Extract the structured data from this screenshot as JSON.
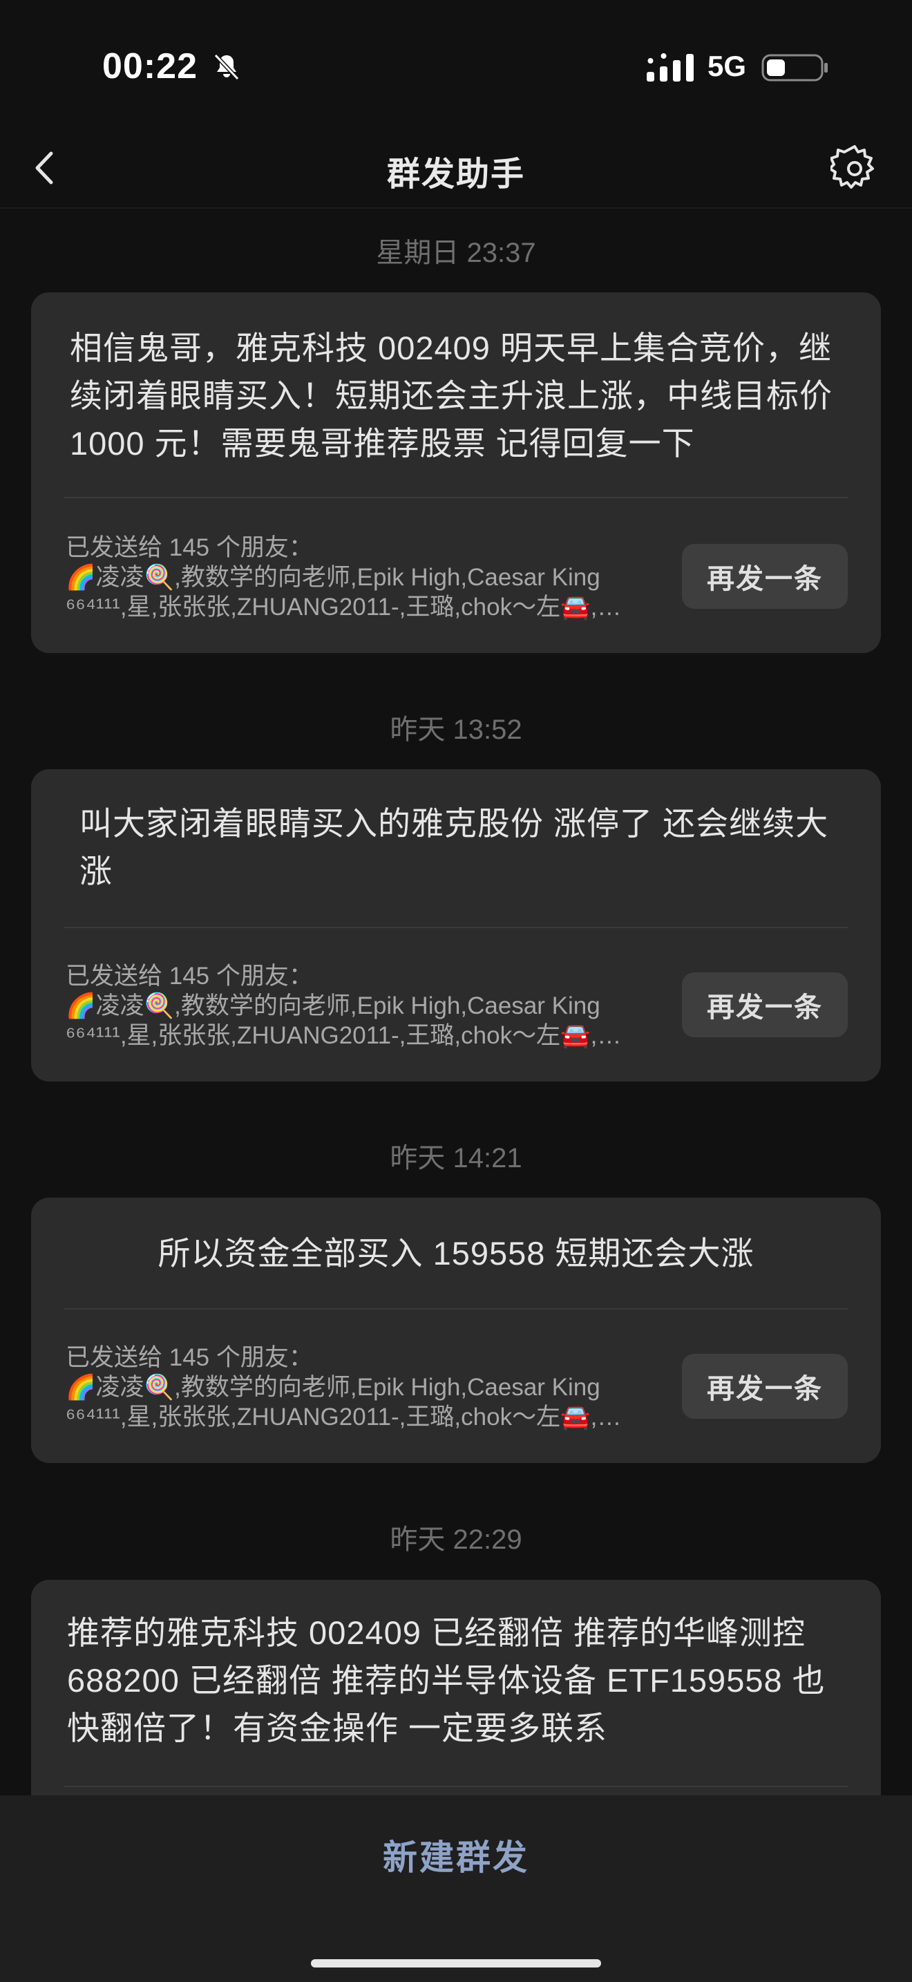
{
  "status": {
    "time": "00:22",
    "network": "5G"
  },
  "nav": {
    "title": "群发助手"
  },
  "messages": [
    {
      "timestamp": "星期日 23:37",
      "text": "相信鬼哥，雅克科技 002409 明天早上集合竞价，继续闭着眼睛买入！短期还会主升浪上涨，中线目标价 1000 元！需要鬼哥推荐股票 记得回复一下",
      "sent_info": "已发送给 145 个朋友：",
      "recipients_line1": "🌈凌凌🍭,教数学的向老师,Epik High,Caesar King",
      "recipients_line2": "⁶⁶⁴¹¹¹,星,张张张,ZHUANG2011-,王璐,chok～左🚘,…",
      "resend_label": "再发一条"
    },
    {
      "timestamp": "昨天 13:52",
      "text": "叫大家闭着眼睛买入的雅克股份 涨停了 还会继续大涨",
      "sent_info": "已发送给 145 个朋友：",
      "recipients_line1": "🌈凌凌🍭,教数学的向老师,Epik High,Caesar King",
      "recipients_line2": "⁶⁶⁴¹¹¹,星,张张张,ZHUANG2011-,王璐,chok～左🚘,…",
      "resend_label": "再发一条"
    },
    {
      "timestamp": "昨天 14:21",
      "text": "所以资金全部买入 159558 短期还会大涨",
      "sent_info": "已发送给 145 个朋友：",
      "recipients_line1": "🌈凌凌🍭,教数学的向老师,Epik High,Caesar King",
      "recipients_line2": "⁶⁶⁴¹¹¹,星,张张张,ZHUANG2011-,王璐,chok～左🚘,…",
      "resend_label": "再发一条"
    },
    {
      "timestamp": "昨天 22:29",
      "text": "推荐的雅克科技 002409 已经翻倍 推荐的华峰测控 688200 已经翻倍 推荐的半导体设备 ETF159558 也快翻倍了！有资金操作 一定要多联系"
    }
  ],
  "bottom": {
    "new_broadcast_label": "新建群发"
  },
  "icons": {
    "mute": "bell-slash-icon",
    "signal": "signal-bars-icon",
    "battery": "battery-icon",
    "back": "chevron-left-icon",
    "settings": "gear-icon"
  },
  "colors": {
    "background": "#111111",
    "card": "#2c2c2c",
    "accent": "#8fa3c8"
  }
}
